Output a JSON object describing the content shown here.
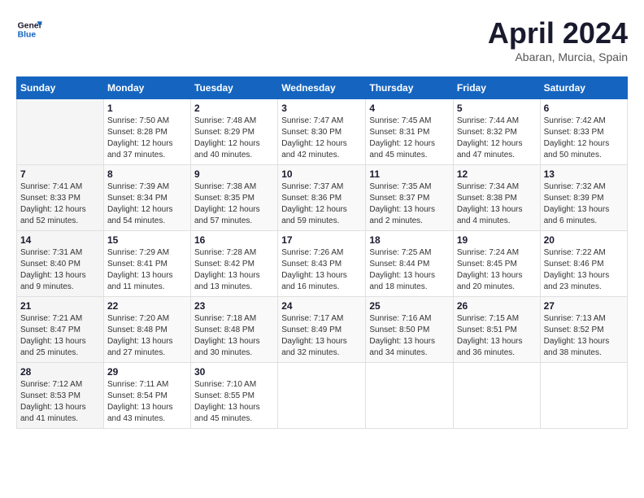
{
  "header": {
    "logo_line1": "General",
    "logo_line2": "Blue",
    "month_title": "April 2024",
    "location": "Abaran, Murcia, Spain"
  },
  "days_of_week": [
    "Sunday",
    "Monday",
    "Tuesday",
    "Wednesday",
    "Thursday",
    "Friday",
    "Saturday"
  ],
  "weeks": [
    [
      {
        "day": "",
        "sunrise": "",
        "sunset": "",
        "daylight": ""
      },
      {
        "day": "1",
        "sunrise": "Sunrise: 7:50 AM",
        "sunset": "Sunset: 8:28 PM",
        "daylight": "Daylight: 12 hours and 37 minutes."
      },
      {
        "day": "2",
        "sunrise": "Sunrise: 7:48 AM",
        "sunset": "Sunset: 8:29 PM",
        "daylight": "Daylight: 12 hours and 40 minutes."
      },
      {
        "day": "3",
        "sunrise": "Sunrise: 7:47 AM",
        "sunset": "Sunset: 8:30 PM",
        "daylight": "Daylight: 12 hours and 42 minutes."
      },
      {
        "day": "4",
        "sunrise": "Sunrise: 7:45 AM",
        "sunset": "Sunset: 8:31 PM",
        "daylight": "Daylight: 12 hours and 45 minutes."
      },
      {
        "day": "5",
        "sunrise": "Sunrise: 7:44 AM",
        "sunset": "Sunset: 8:32 PM",
        "daylight": "Daylight: 12 hours and 47 minutes."
      },
      {
        "day": "6",
        "sunrise": "Sunrise: 7:42 AM",
        "sunset": "Sunset: 8:33 PM",
        "daylight": "Daylight: 12 hours and 50 minutes."
      }
    ],
    [
      {
        "day": "7",
        "sunrise": "Sunrise: 7:41 AM",
        "sunset": "Sunset: 8:33 PM",
        "daylight": "Daylight: 12 hours and 52 minutes."
      },
      {
        "day": "8",
        "sunrise": "Sunrise: 7:39 AM",
        "sunset": "Sunset: 8:34 PM",
        "daylight": "Daylight: 12 hours and 54 minutes."
      },
      {
        "day": "9",
        "sunrise": "Sunrise: 7:38 AM",
        "sunset": "Sunset: 8:35 PM",
        "daylight": "Daylight: 12 hours and 57 minutes."
      },
      {
        "day": "10",
        "sunrise": "Sunrise: 7:37 AM",
        "sunset": "Sunset: 8:36 PM",
        "daylight": "Daylight: 12 hours and 59 minutes."
      },
      {
        "day": "11",
        "sunrise": "Sunrise: 7:35 AM",
        "sunset": "Sunset: 8:37 PM",
        "daylight": "Daylight: 13 hours and 2 minutes."
      },
      {
        "day": "12",
        "sunrise": "Sunrise: 7:34 AM",
        "sunset": "Sunset: 8:38 PM",
        "daylight": "Daylight: 13 hours and 4 minutes."
      },
      {
        "day": "13",
        "sunrise": "Sunrise: 7:32 AM",
        "sunset": "Sunset: 8:39 PM",
        "daylight": "Daylight: 13 hours and 6 minutes."
      }
    ],
    [
      {
        "day": "14",
        "sunrise": "Sunrise: 7:31 AM",
        "sunset": "Sunset: 8:40 PM",
        "daylight": "Daylight: 13 hours and 9 minutes."
      },
      {
        "day": "15",
        "sunrise": "Sunrise: 7:29 AM",
        "sunset": "Sunset: 8:41 PM",
        "daylight": "Daylight: 13 hours and 11 minutes."
      },
      {
        "day": "16",
        "sunrise": "Sunrise: 7:28 AM",
        "sunset": "Sunset: 8:42 PM",
        "daylight": "Daylight: 13 hours and 13 minutes."
      },
      {
        "day": "17",
        "sunrise": "Sunrise: 7:26 AM",
        "sunset": "Sunset: 8:43 PM",
        "daylight": "Daylight: 13 hours and 16 minutes."
      },
      {
        "day": "18",
        "sunrise": "Sunrise: 7:25 AM",
        "sunset": "Sunset: 8:44 PM",
        "daylight": "Daylight: 13 hours and 18 minutes."
      },
      {
        "day": "19",
        "sunrise": "Sunrise: 7:24 AM",
        "sunset": "Sunset: 8:45 PM",
        "daylight": "Daylight: 13 hours and 20 minutes."
      },
      {
        "day": "20",
        "sunrise": "Sunrise: 7:22 AM",
        "sunset": "Sunset: 8:46 PM",
        "daylight": "Daylight: 13 hours and 23 minutes."
      }
    ],
    [
      {
        "day": "21",
        "sunrise": "Sunrise: 7:21 AM",
        "sunset": "Sunset: 8:47 PM",
        "daylight": "Daylight: 13 hours and 25 minutes."
      },
      {
        "day": "22",
        "sunrise": "Sunrise: 7:20 AM",
        "sunset": "Sunset: 8:48 PM",
        "daylight": "Daylight: 13 hours and 27 minutes."
      },
      {
        "day": "23",
        "sunrise": "Sunrise: 7:18 AM",
        "sunset": "Sunset: 8:48 PM",
        "daylight": "Daylight: 13 hours and 30 minutes."
      },
      {
        "day": "24",
        "sunrise": "Sunrise: 7:17 AM",
        "sunset": "Sunset: 8:49 PM",
        "daylight": "Daylight: 13 hours and 32 minutes."
      },
      {
        "day": "25",
        "sunrise": "Sunrise: 7:16 AM",
        "sunset": "Sunset: 8:50 PM",
        "daylight": "Daylight: 13 hours and 34 minutes."
      },
      {
        "day": "26",
        "sunrise": "Sunrise: 7:15 AM",
        "sunset": "Sunset: 8:51 PM",
        "daylight": "Daylight: 13 hours and 36 minutes."
      },
      {
        "day": "27",
        "sunrise": "Sunrise: 7:13 AM",
        "sunset": "Sunset: 8:52 PM",
        "daylight": "Daylight: 13 hours and 38 minutes."
      }
    ],
    [
      {
        "day": "28",
        "sunrise": "Sunrise: 7:12 AM",
        "sunset": "Sunset: 8:53 PM",
        "daylight": "Daylight: 13 hours and 41 minutes."
      },
      {
        "day": "29",
        "sunrise": "Sunrise: 7:11 AM",
        "sunset": "Sunset: 8:54 PM",
        "daylight": "Daylight: 13 hours and 43 minutes."
      },
      {
        "day": "30",
        "sunrise": "Sunrise: 7:10 AM",
        "sunset": "Sunset: 8:55 PM",
        "daylight": "Daylight: 13 hours and 45 minutes."
      },
      {
        "day": "",
        "sunrise": "",
        "sunset": "",
        "daylight": ""
      },
      {
        "day": "",
        "sunrise": "",
        "sunset": "",
        "daylight": ""
      },
      {
        "day": "",
        "sunrise": "",
        "sunset": "",
        "daylight": ""
      },
      {
        "day": "",
        "sunrise": "",
        "sunset": "",
        "daylight": ""
      }
    ]
  ]
}
